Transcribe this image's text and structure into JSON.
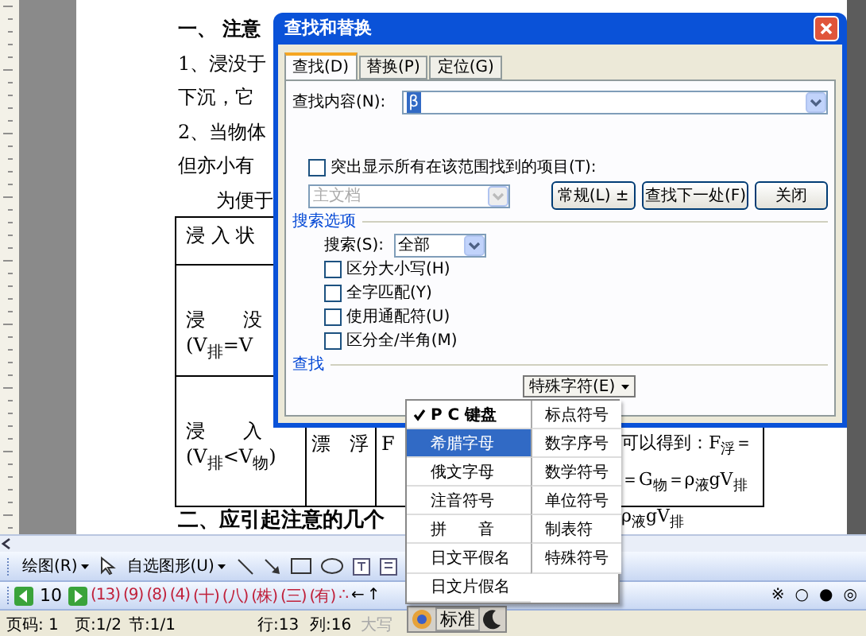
{
  "document": {
    "paragraphs": [
      {
        "kind": "heading",
        "text": "一、 注意"
      },
      {
        "kind": "body",
        "text": "1、浸没于"
      },
      {
        "kind": "body",
        "text": "下沉，它"
      },
      {
        "kind": "body",
        "text": "2、当物体"
      },
      {
        "kind": "body",
        "text": "但亦小有"
      },
      {
        "kind": "indent",
        "text": "为便于"
      }
    ],
    "table": [
      {
        "cells": [
          {
            "lines": [
              "浸 入 状"
            ]
          },
          {},
          {}
        ]
      },
      {
        "cells": [
          {
            "lines": [
              "浸　　没",
              "(V$_{排}$=V"
            ]
          },
          {},
          {}
        ]
      },
      {
        "cells": [
          {
            "lines": [
              "浸　　入",
              "(V$_{排}$<V$_{物}$)"
            ]
          },
          {
            "lines": [
              "漂　浮"
            ]
          },
          {
            "lines": [
              "F"
            ],
            "aside": [
              "可以得到：F$_{浮}$＝",
              "＝G$_{物}$＝ρ$_{液}$gV$_{排}$",
              "ρ$_{液}$gV$_{排}$"
            ]
          }
        ]
      }
    ],
    "heading2": "二、应引起注意的几个"
  },
  "drawing_toolbar": {
    "draw_menu": "绘图(R)",
    "autoshapes_menu": "自选图形(U)"
  },
  "symbol_toolbar": {
    "page": "10",
    "symbols": [
      "(13)",
      "(9)",
      "(8)",
      "(4)",
      "(十)",
      "(八)",
      "(株)",
      "(三)",
      "(有)",
      "∴"
    ],
    "arrows": [
      "←",
      "↑"
    ],
    "right_symbols": [
      "※",
      "○",
      "●",
      "◎"
    ]
  },
  "status_bar": [
    {
      "text": "页码: 1",
      "disabled": false
    },
    {
      "text": "页:1/2",
      "disabled": false
    },
    {
      "text": "节:1/1",
      "disabled": false
    },
    {
      "text": "行:13",
      "disabled": false
    },
    {
      "text": "列:16",
      "disabled": false
    },
    {
      "text": "大写",
      "disabled": true
    }
  ],
  "ime": {
    "mode": "标准"
  },
  "dialog": {
    "title": "查找和替换",
    "tabs": [
      {
        "label": "查找(D)",
        "selected": true
      },
      {
        "label": "替换(P)",
        "selected": false
      },
      {
        "label": "定位(G)",
        "selected": false
      }
    ],
    "find_label": "查找内容(N):",
    "find_value": "β",
    "highlight": {
      "label": "突出显示所有在该范围找到的项目(T):",
      "checked": false
    },
    "scope": {
      "value": "主文档",
      "disabled": true
    },
    "buttons": [
      "常规(L) ±",
      "查找下一处(F)",
      "关闭"
    ],
    "options_heading": "搜索选项",
    "search_label": "搜索(S):",
    "search_value": "全部",
    "options": [
      {
        "label": "区分大小写(H)",
        "checked": false
      },
      {
        "label": "全字匹配(Y)",
        "checked": false
      },
      {
        "label": "使用通配符(U)",
        "checked": false
      },
      {
        "label": "区分全/半角(M)",
        "checked": false
      }
    ],
    "find_heading": "查找",
    "special_button": "特殊字符(E)"
  },
  "menu": {
    "left": [
      {
        "label": "P C 键盘",
        "checked": true,
        "selected": false
      },
      {
        "label": "希腊字母",
        "checked": false,
        "selected": true
      },
      {
        "label": "俄文字母",
        "checked": false,
        "selected": false
      },
      {
        "label": "注音符号",
        "checked": false,
        "selected": false
      },
      {
        "label": "拼　　音",
        "checked": false,
        "selected": false
      },
      {
        "label": "日文平假名",
        "checked": false,
        "selected": false
      },
      {
        "label": "日文片假名",
        "checked": false,
        "selected": false
      }
    ],
    "right": [
      {
        "label": "标点符号",
        "selected": false
      },
      {
        "label": "数字序号",
        "selected": false
      },
      {
        "label": "数学符号",
        "selected": false
      },
      {
        "label": "单位符号",
        "selected": false
      },
      {
        "label": "制表符",
        "selected": false
      },
      {
        "label": "特殊符号",
        "selected": false
      }
    ]
  }
}
